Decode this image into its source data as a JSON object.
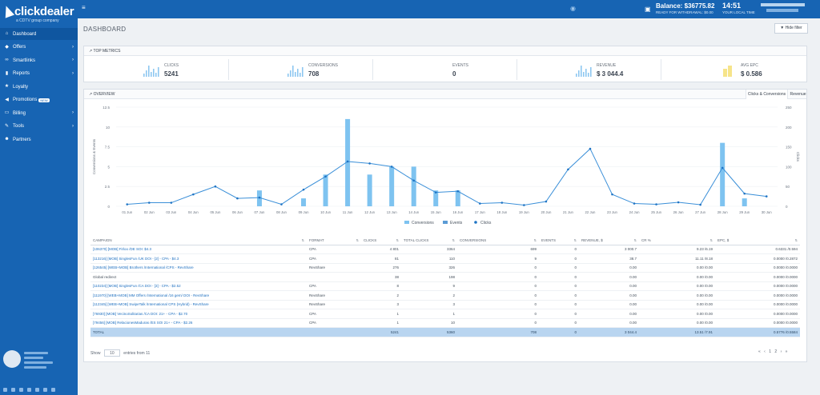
{
  "brand": {
    "name": "clickdealer",
    "sub": "a CDTV group company"
  },
  "sidebar": {
    "items": [
      {
        "label": "Dashboard",
        "icon": "home-icon",
        "chev": ""
      },
      {
        "label": "Offers",
        "icon": "tag-icon",
        "chev": "›"
      },
      {
        "label": "Smartlinks",
        "icon": "link-icon",
        "chev": "›"
      },
      {
        "label": "Reports",
        "icon": "bar-chart-icon",
        "chev": "›"
      },
      {
        "label": "Loyalty",
        "icon": "star-icon",
        "chev": ""
      },
      {
        "label": "Promotions",
        "icon": "megaphone-icon",
        "chev": "",
        "badge": "NEW"
      },
      {
        "label": "Billing",
        "icon": "card-icon",
        "chev": "›"
      },
      {
        "label": "Tools",
        "icon": "wrench-icon",
        "chev": "›"
      },
      {
        "label": "Partners",
        "icon": "users-icon",
        "chev": ""
      }
    ]
  },
  "topbar": {
    "balance": "Balance: $36775.82",
    "withdraw": "READY FOR WITHDRAWAL: $0.00",
    "time": "14:51",
    "time_label": "YOUR LOCAL TIME"
  },
  "page": {
    "title": "DASHBOARD",
    "hide_filter": "▼ Hide filter"
  },
  "metrics": {
    "header": "TOP METRICS",
    "items": [
      {
        "label": "CLICKS",
        "value": "5241",
        "icon": "clicks-sparkline"
      },
      {
        "label": "CONVERSIONS",
        "value": "708",
        "icon": "conversions-sparkline"
      },
      {
        "label": "EVENTS",
        "value": "0",
        "icon": ""
      },
      {
        "label": "REVENUE",
        "value": "$ 3 044.4",
        "icon": "revenue-sparkline"
      },
      {
        "label": "AVG EPC",
        "value": "$ 0.586",
        "icon": "epc-sparkline"
      }
    ]
  },
  "overview": {
    "header": "OVERVIEW",
    "tabs": [
      "Clicks & Conversions",
      "Revenue"
    ]
  },
  "chart_data": {
    "type": "bar",
    "categories": [
      "01 Jun",
      "02 Jun",
      "03 Jun",
      "04 Jun",
      "05 Jun",
      "06 Jun",
      "07 Jun",
      "08 Jun",
      "09 Jun",
      "10 Jun",
      "11 Jun",
      "12 Jun",
      "13 Jun",
      "14 Jun",
      "15 Jun",
      "16 Jun",
      "17 Jun",
      "18 Jun",
      "19 Jun",
      "20 Jun",
      "21 Jun",
      "22 Jun",
      "23 Jun",
      "24 Jun",
      "25 Jun",
      "26 Jun",
      "27 Jun",
      "28 Jun",
      "29 Jun",
      "30 Jun"
    ],
    "y_left": {
      "label": "Conversions & Events",
      "ticks": [
        "0",
        "2.5",
        "5",
        "7.5",
        "10",
        "12.5"
      ],
      "range": [
        0,
        12.5
      ]
    },
    "y_right": {
      "label": "Clicks",
      "ticks": [
        "0",
        "50",
        "100",
        "150",
        "200",
        "250"
      ],
      "range": [
        0,
        250
      ]
    },
    "series": [
      {
        "name": "Conversions",
        "type": "bar",
        "color": "#7ec3f0",
        "values": [
          0,
          0,
          0,
          0,
          0,
          0,
          2,
          0,
          1,
          4,
          11,
          4,
          5,
          5,
          2,
          2,
          0,
          0,
          0,
          0,
          0,
          0,
          0,
          0,
          0,
          0,
          0,
          8,
          1,
          0
        ]
      },
      {
        "name": "Events",
        "type": "bar",
        "color": "#5b9bd5",
        "values": [
          0,
          0,
          0,
          0,
          0,
          0,
          0,
          0,
          0,
          0,
          0,
          0,
          0,
          0,
          0,
          0,
          0,
          0,
          0,
          0,
          0,
          0,
          0,
          0,
          0,
          0,
          0,
          0,
          0,
          0
        ]
      },
      {
        "name": "Clicks",
        "type": "line",
        "color": "#3a8fd8",
        "values": [
          5,
          9,
          9,
          30,
          50,
          20,
          22,
          5,
          42,
          75,
          113,
          108,
          100,
          65,
          35,
          38,
          7,
          9,
          3,
          12,
          93,
          145,
          30,
          7,
          5,
          10,
          4,
          97,
          32,
          25
        ]
      }
    ],
    "legend": [
      "Conversions",
      "Events",
      "Clicks"
    ]
  },
  "table": {
    "columns": [
      "CAMPAIGN",
      "FORMAT",
      "CLICKS",
      "TOTAL CLICKS",
      "CONVERSIONS",
      "EVENTS",
      "REVENUE, $",
      "CR %",
      "EPC, $"
    ],
    "rows": [
      [
        "[106370] [MOB] Firloo /DE SOI: $4.3",
        "CPA",
        "4 801",
        "3364",
        "699",
        "0",
        "3 000.7",
        "9.23 /6.19",
        "0.6331 /0.594"
      ],
      [
        "[113216] [MOB] SinglesFun /UK DOI - [2] - CPA - $4.3",
        "CPA",
        "81",
        "110",
        "9",
        "0",
        "38.7",
        "11.11 /8.18",
        "0.0000 /0.2872"
      ],
      [
        "[126545] [WEB+MOB] Brothers /International /CPS - RevShare",
        "RevShare",
        "276",
        "326",
        "0",
        "0",
        "0.00",
        "0.00 /0.00",
        "0.0000 /0.0000"
      ],
      [
        "Global redirect",
        "",
        "38",
        "198",
        "0",
        "0",
        "0.00",
        "0.00 /0.00",
        "0.0000 /0.0000"
      ],
      [
        "[110234] [MOB] SinglesFun /CA DOI - [3] - CPA - $2.52",
        "CPA",
        "8",
        "9",
        "0",
        "0",
        "0.00",
        "0.00 /0.00",
        "0.0000 /0.0000"
      ],
      [
        "[111970] [WEB+MOB] MM Offers /International /16 gem/ DOI - RevShare",
        "RevShare",
        "2",
        "2",
        "0",
        "0",
        "0.00",
        "0.00 /0.00",
        "0.0000 /0.0000"
      ],
      [
        "[112345] [WEB+MOB] SwipeTalk /International CPS (Hybrid) - RevShare",
        "RevShare",
        "3",
        "3",
        "0",
        "0",
        "0.00",
        "0.00 /0.00",
        "0.0000 /0.0000"
      ],
      [
        "[76930] [MOB] VecinoSolitarias /CA DOI: 21+ - CPA - $2.70",
        "CPA",
        "1",
        "1",
        "0",
        "0",
        "0.00",
        "0.00 /0.00",
        "0.0000 /0.0000"
      ],
      [
        "[79456] [MOB] RelacionesMaduras /ES SOI 21+ - CPA - $2.26",
        "CPA",
        "1",
        "10",
        "0",
        "0",
        "0.00",
        "0.00 /0.00",
        "0.0000 /0.0000"
      ]
    ],
    "total": [
      "TOTAL",
      "",
      "5241",
      "5360",
      "708",
      "0",
      "3 044.4",
      "13.51 /7.91",
      "0.5776 /0.5584"
    ]
  },
  "pager": {
    "show": "Show",
    "size": "10",
    "suffix": "entries from 11",
    "pages": "« ‹ 1 2 › »"
  }
}
